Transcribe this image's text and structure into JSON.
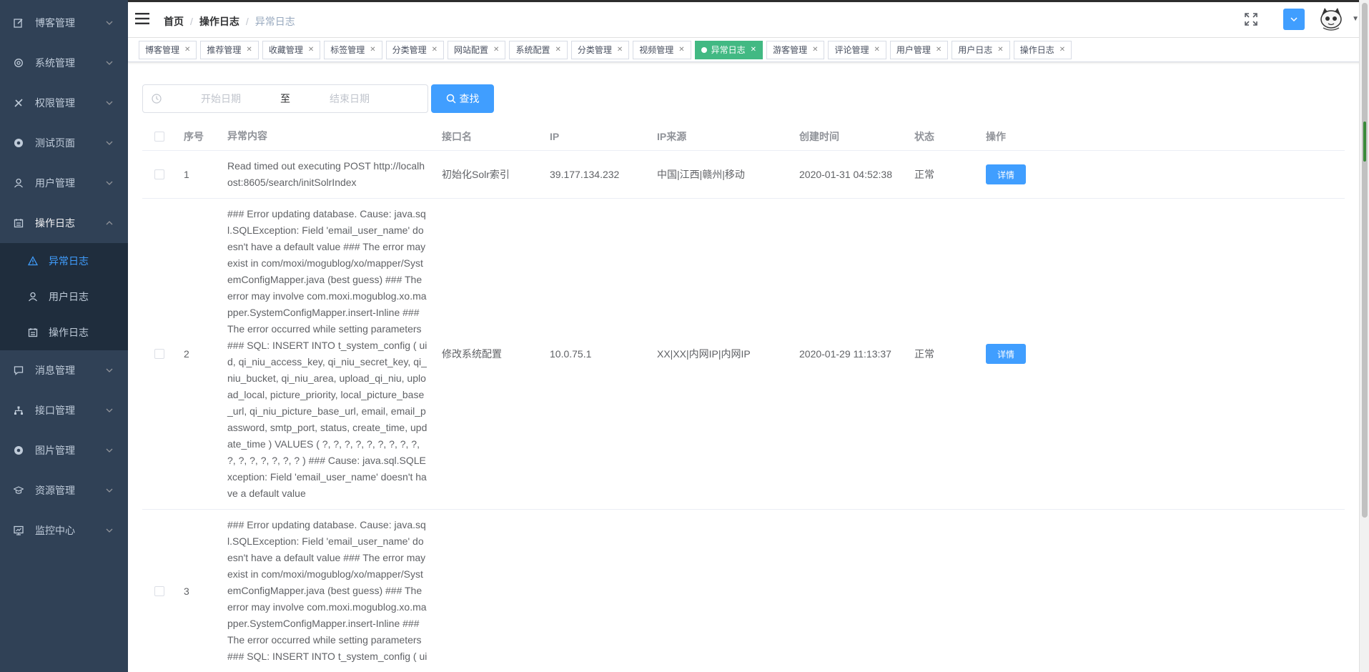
{
  "sidebar": {
    "items": [
      {
        "label": "博客管理",
        "icon": "edit-icon"
      },
      {
        "label": "系统管理",
        "icon": "gear-icon"
      },
      {
        "label": "权限管理",
        "icon": "tools-icon"
      },
      {
        "label": "测试页面",
        "icon": "aperture-icon"
      },
      {
        "label": "用户管理",
        "icon": "user-icon"
      },
      {
        "label": "操作日志",
        "icon": "calendar-icon",
        "expanded": true,
        "children": [
          {
            "label": "异常日志",
            "icon": "warning-icon",
            "active": true
          },
          {
            "label": "用户日志",
            "icon": "user-icon"
          },
          {
            "label": "操作日志",
            "icon": "calendar-icon"
          }
        ]
      },
      {
        "label": "消息管理",
        "icon": "message-icon"
      },
      {
        "label": "接口管理",
        "icon": "network-icon"
      },
      {
        "label": "图片管理",
        "icon": "aperture-icon"
      },
      {
        "label": "资源管理",
        "icon": "graduation-cap-icon"
      },
      {
        "label": "监控中心",
        "icon": "monitor-icon"
      }
    ]
  },
  "breadcrumb": [
    "首页",
    "操作日志",
    "异常日志"
  ],
  "tags": [
    {
      "label": "博客管理"
    },
    {
      "label": "推荐管理"
    },
    {
      "label": "收藏管理"
    },
    {
      "label": "标签管理"
    },
    {
      "label": "分类管理"
    },
    {
      "label": "网站配置"
    },
    {
      "label": "系统配置"
    },
    {
      "label": "分类管理"
    },
    {
      "label": "视频管理"
    },
    {
      "label": "异常日志",
      "active": true
    },
    {
      "label": "游客管理"
    },
    {
      "label": "评论管理"
    },
    {
      "label": "用户管理"
    },
    {
      "label": "用户日志"
    },
    {
      "label": "操作日志"
    }
  ],
  "filter": {
    "start_placeholder": "开始日期",
    "range_separator": "至",
    "end_placeholder": "结束日期",
    "search_label": "查找"
  },
  "table": {
    "headers": {
      "index": "序号",
      "message": "异常内容",
      "api": "接口名",
      "ip": "IP",
      "source": "IP来源",
      "time": "创建时间",
      "status": "状态",
      "op": "操作"
    },
    "rows": [
      {
        "index": "1",
        "message": "Read timed out executing POST http://localhost:8605/search/initSolrIndex",
        "api": "初始化Solr索引",
        "ip": "39.177.134.232",
        "source": "中国|江西|赣州|移动",
        "time": "2020-01-31 04:52:38",
        "status": "正常",
        "op": "详情"
      },
      {
        "index": "2",
        "message": "### Error updating database. Cause: java.sql.SQLException: Field 'email_user_name' doesn't have a default value ### The error may exist in com/moxi/mogublog/xo/mapper/SystemConfigMapper.java (best guess) ### The error may involve com.moxi.mogublog.xo.mapper.SystemConfigMapper.insert-Inline ### The error occurred while setting parameters ### SQL: INSERT INTO t_system_config ( uid, qi_niu_access_key, qi_niu_secret_key, qi_niu_bucket, qi_niu_area, upload_qi_niu, upload_local, picture_priority, local_picture_base_url, qi_niu_picture_base_url, email, email_password, smtp_port, status, create_time, update_time ) VALUES ( ?, ?, ?, ?, ?, ?, ?, ?, ?, ?, ?, ?, ?, ?, ?, ? ) ### Cause: java.sql.SQLException: Field 'email_user_name' doesn't have a default value",
        "api": "修改系统配置",
        "ip": "10.0.75.1",
        "source": "XX|XX|内网IP|内网IP",
        "time": "2020-01-29 11:13:37",
        "status": "正常",
        "op": "详情"
      },
      {
        "index": "3",
        "message": "### Error updating database. Cause: java.sql.SQLException: Field 'email_user_name' doesn't have a default value ### The error may exist in com/moxi/mogublog/xo/mapper/SystemConfigMapper.java (best guess) ### The error may involve com.moxi.mogublog.xo.mapper.SystemConfigMapper.insert-Inline ### The error occurred while setting parameters ### SQL: INSERT INTO t_system_config ( ui",
        "api": "",
        "ip": "",
        "source": "",
        "time": "",
        "status": "",
        "op": ""
      }
    ]
  },
  "colors": {
    "sidebar_bg": "#304156",
    "submenu_bg": "#1f2d3d",
    "primary": "#409eff",
    "active_tag": "#42b983"
  }
}
